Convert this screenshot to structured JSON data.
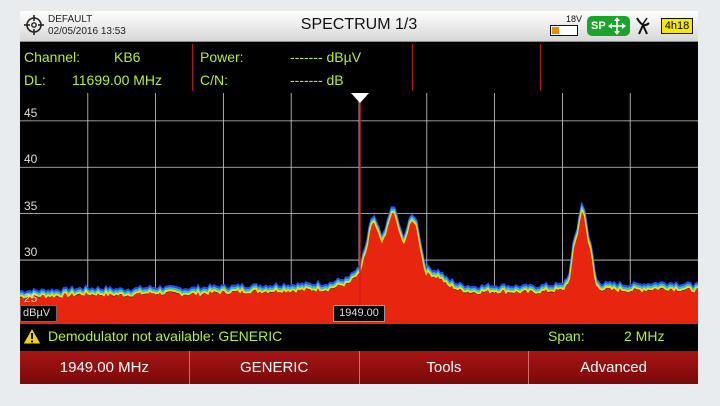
{
  "header": {
    "profile": "DEFAULT",
    "datetime": "02/05/2016 13:53",
    "title": "SPECTRUM 1/3",
    "battery_voltage": "18V",
    "battery_level_fraction": 0.3,
    "sp_label": "SP",
    "time_remaining": "4h18",
    "icons": [
      "target-icon",
      "battery-icon",
      "arrows-icon",
      "antenna-icon"
    ]
  },
  "info": {
    "channel_label": "Channel:",
    "channel_value": "KB6",
    "dl_label": "DL:",
    "dl_value": "11699.00 MHz",
    "power_label": "Power:",
    "power_value": "------- dBµV",
    "cn_label": "C/N:",
    "cn_value": "------- dB"
  },
  "spectrum": {
    "unit": "dBµV",
    "marker_freq": "1949.00",
    "y_ticks": [
      "45",
      "40",
      "35",
      "30",
      "25"
    ],
    "colors": {
      "fill": "#e8260f",
      "trace_top": "#2a4cff",
      "trace_mid": "#2fc2c8",
      "trace_low": "#e6e01b",
      "marker": "#d51818",
      "grid": "#cfcfcf"
    }
  },
  "status": {
    "warning": "Demodulator not available: GENERIC",
    "span_label": "Span:",
    "span_value": "2 MHz"
  },
  "softkeys": [
    "1949.00 MHz",
    "GENERIC",
    "Tools",
    "Advanced"
  ],
  "chart_data": {
    "type": "area",
    "ylabel": "dBµV",
    "y_ticks": [
      45,
      40,
      35,
      30,
      25
    ],
    "ylim": [
      23,
      48
    ],
    "x": [
      0,
      0.05,
      0.1,
      0.15,
      0.2,
      0.25,
      0.3,
      0.35,
      0.4,
      0.45,
      0.48,
      0.5,
      0.51,
      0.52,
      0.535,
      0.55,
      0.565,
      0.58,
      0.6,
      0.615,
      0.635,
      0.65,
      0.67,
      0.7,
      0.75,
      0.8,
      0.81,
      0.82,
      0.83,
      0.84,
      0.85,
      0.86,
      0.9,
      0.95,
      1.0
    ],
    "series": [
      {
        "values": [
          26.3,
          26.4,
          26.6,
          26.5,
          26.7,
          26.6,
          26.8,
          26.9,
          27.0,
          27.1,
          27.6,
          28.6,
          31.0,
          34.2,
          32.3,
          35.3,
          32.2,
          34.5,
          28.8,
          28.5,
          27.4,
          27.0,
          26.8,
          26.9,
          26.8,
          27.0,
          28.0,
          32.5,
          35.6,
          31.5,
          27.5,
          27.1,
          27.0,
          27.2,
          27.0
        ]
      }
    ]
  }
}
